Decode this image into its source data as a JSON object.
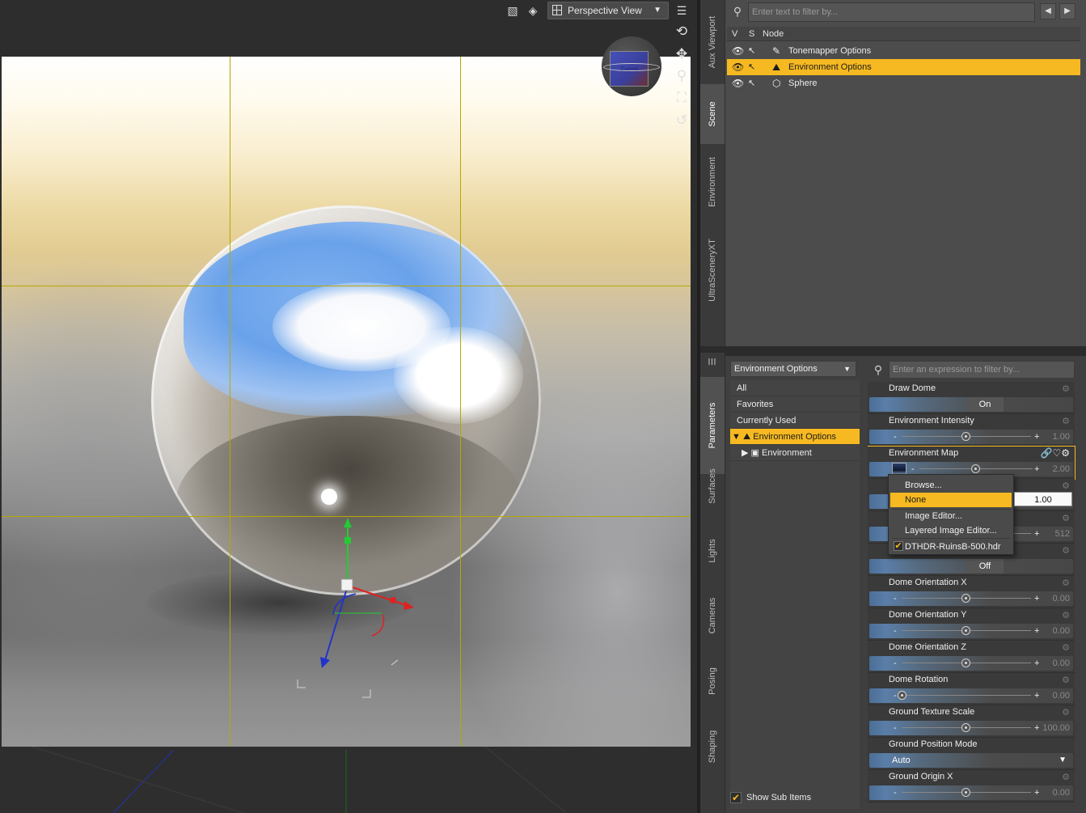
{
  "viewport": {
    "view_name": "Perspective View",
    "nav_cube_face": "Front",
    "toolbar_icons": [
      "draw-style-icon",
      "camera-icon",
      "viewport-menu-icon"
    ],
    "nav_tools": [
      "orbit-icon",
      "pan-icon",
      "zoom-icon",
      "frame-icon",
      "reset-icon"
    ]
  },
  "side_tabs_top": [
    "Aux Viewport",
    "Scene",
    "Environment",
    "UltraSceneryXT"
  ],
  "side_tabs_bottom": [
    "Parameters",
    "Surfaces",
    "Lights",
    "Cameras",
    "Posing",
    "Shaping"
  ],
  "scene": {
    "filter_placeholder": "Enter text to filter by...",
    "columns": {
      "v": "V",
      "s": "S",
      "node": "Node"
    },
    "nodes": [
      {
        "label": "Tonemapper Options",
        "icon": "tonemapper-icon",
        "selected": false
      },
      {
        "label": "Environment Options",
        "icon": "environment-icon",
        "selected": true
      },
      {
        "label": "Sphere",
        "icon": "sphere-icon",
        "selected": false
      }
    ]
  },
  "parameters": {
    "node_select": "Environment Options",
    "groups": [
      {
        "label": "All"
      },
      {
        "label": "Favorites"
      },
      {
        "label": "Currently Used"
      },
      {
        "label": "Environment Options",
        "selected": true
      },
      {
        "label": "Environment"
      }
    ],
    "show_sub_items": "Show Sub Items",
    "expression_placeholder": "Enter an expression to filter by...",
    "items": [
      {
        "name": "Draw Dome",
        "kind": "toggle",
        "value": "On"
      },
      {
        "name": "Environment Intensity",
        "kind": "slider",
        "value": "1.00"
      },
      {
        "name": "Environment Map",
        "kind": "map",
        "value": "2.00"
      },
      {
        "name": "",
        "kind": "hidden",
        "value": ""
      },
      {
        "name": "",
        "kind": "slider",
        "value": "512"
      },
      {
        "name": "",
        "kind": "toggle",
        "value": "Off"
      },
      {
        "name": "Dome Orientation X",
        "kind": "slider",
        "value": "0.00"
      },
      {
        "name": "Dome Orientation Y",
        "kind": "slider",
        "value": "0.00"
      },
      {
        "name": "Dome Orientation Z",
        "kind": "slider",
        "value": "0.00"
      },
      {
        "name": "Dome Rotation",
        "kind": "slider",
        "value": "0.00"
      },
      {
        "name": "Ground Texture Scale",
        "kind": "slider",
        "value": "100.00"
      },
      {
        "name": "Ground Position Mode",
        "kind": "dropdown",
        "value": "Auto"
      },
      {
        "name": "Ground Origin X",
        "kind": "slider",
        "value": "0.00"
      }
    ]
  },
  "context_menu": {
    "items": [
      "Browse...",
      "None",
      "Image Editor...",
      "Layered Image Editor...",
      "DTHDR-RuinsB-500.hdr"
    ],
    "selected": "None",
    "edit_value": "1.00"
  }
}
